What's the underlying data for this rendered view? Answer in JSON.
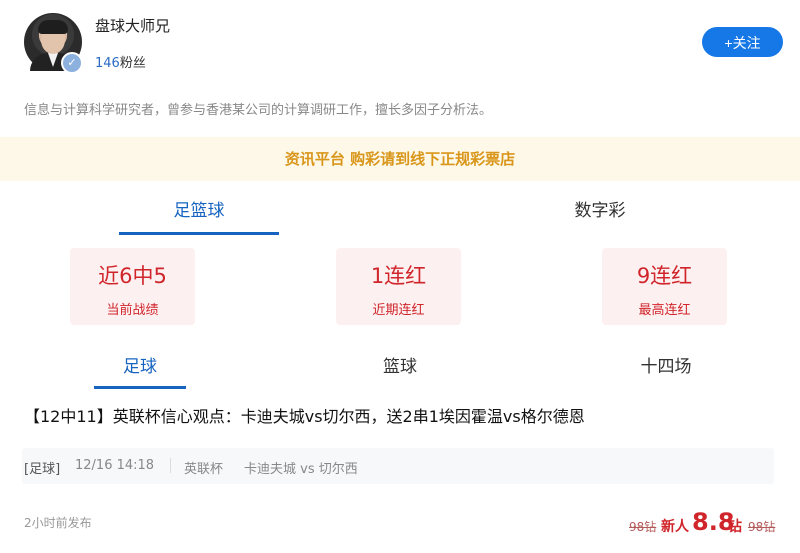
{
  "profile": {
    "name": "盘球大师兄",
    "fans_count": "146",
    "fans_label": "粉丝",
    "follow_label": "+关注",
    "bio": "信息与计算科学研究者，曾参与香港某公司的计算调研工作，擅长多因子分析法。"
  },
  "notice": "资讯平台 购彩请到线下正规彩票店",
  "main_tabs": [
    {
      "label": "足篮球",
      "active": true
    },
    {
      "label": "数字彩",
      "active": false
    }
  ],
  "stats": [
    {
      "value": "近6中5",
      "label": "当前战绩"
    },
    {
      "value": "1连红",
      "label": "近期连红"
    },
    {
      "value": "9连红",
      "label": "最高连红"
    }
  ],
  "sub_tabs": [
    {
      "label": "足球",
      "active": true
    },
    {
      "label": "篮球",
      "active": false
    },
    {
      "label": "十四场",
      "active": false
    }
  ],
  "article": {
    "title": "【12中11】英联杯信心观点：卡迪夫城vs切尔西，送2串1埃因霍温vs格尔德恩",
    "tag": "[足球]",
    "time": "12/16 14:18",
    "league": "英联杯",
    "match": "卡迪夫城 vs 切尔西",
    "published": "2小时前发布",
    "price_original": "98钻",
    "price_new_label": "新人",
    "price_new_value": "8.8",
    "price_unit": "钻",
    "price_original_2": "98钻"
  },
  "colors": {
    "accent_blue": "#1764c0",
    "follow_button": "#1677e6",
    "stat_red": "#d0252b",
    "notice_text": "#d9961b",
    "notice_bg": "#fdf8e7"
  }
}
